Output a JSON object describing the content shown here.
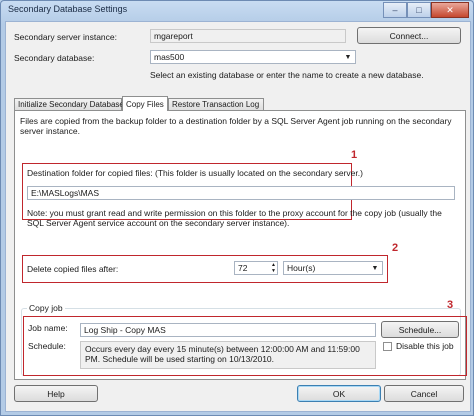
{
  "window": {
    "title": "Secondary Database Settings"
  },
  "server": {
    "label": "Secondary server instance:",
    "value": "mgareport",
    "connect_button": "Connect..."
  },
  "database": {
    "label": "Secondary database:",
    "value": "mas500",
    "hint": "Select an existing database or enter the name to create a new database."
  },
  "tabs": [
    {
      "label": "Initialize Secondary Database",
      "active": false
    },
    {
      "label": "Copy Files",
      "active": true
    },
    {
      "label": "Restore Transaction Log",
      "active": false
    }
  ],
  "copy_files": {
    "description": "Files are copied from the backup folder to a destination folder by a SQL Server Agent job running on the secondary server instance.",
    "destination_label": "Destination folder for copied files: (This folder is usually located on the secondary server.)",
    "destination_value": "E:\\MASLogs\\MAS",
    "note": "Note: you must grant read and write permission on this folder to the proxy account for the copy job (usually the SQL Server Agent service account on the secondary server instance).",
    "delete_label": "Delete copied files after:",
    "delete_value": "72",
    "delete_unit": "Hour(s)",
    "copy_job": {
      "group_title": "Copy job",
      "job_name_label": "Job name:",
      "job_name_value": "Log Ship - Copy MAS",
      "schedule_button": "Schedule...",
      "schedule_label": "Schedule:",
      "schedule_text": "Occurs every day every 15 minute(s) between 12:00:00 AM and 11:59:00 PM. Schedule will be used starting on 10/13/2010.",
      "disable_label": "Disable this job",
      "disable_checked": false
    }
  },
  "annotations": {
    "n1": "1",
    "n2": "2",
    "n3": "3"
  },
  "footer": {
    "help_button": "Help",
    "ok_button": "OK",
    "cancel_button": "Cancel"
  },
  "colors": {
    "annotation_red": "#c0272d",
    "title_bar": "#b3cbe6"
  }
}
